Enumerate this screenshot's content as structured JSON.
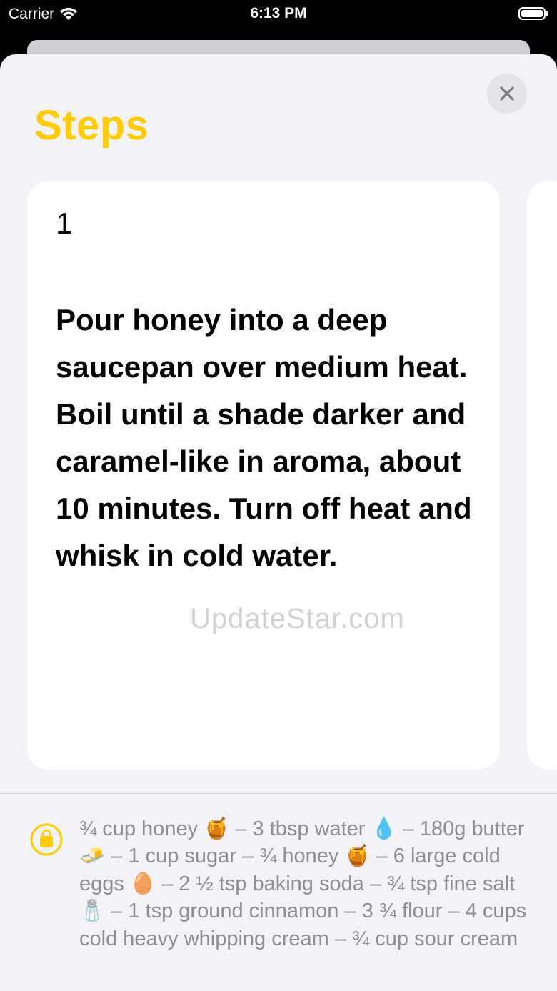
{
  "status_bar": {
    "carrier": "Carrier",
    "time": "6:13 PM"
  },
  "sheet": {
    "title": "Steps",
    "close_icon": "xmark-icon"
  },
  "step_card": {
    "number": "1",
    "text": "Pour honey into a deep saucepan over medium heat. Boil until a shade darker and caramel-like in aroma, about 10 minutes. Turn off heat and whisk in cold water."
  },
  "watermark": "UpdateStar.com",
  "ingredients": {
    "icon": "shopping-bag-icon",
    "text": "¾ cup honey 🍯 – 3 tbsp water 💧 – 180g butter 🧈 – 1 cup sugar – ¾ honey 🍯 – 6 large cold eggs 🥚 – 2 ½ tsp baking soda – ¾ tsp fine salt 🧂 – 1 tsp ground cinnamon – 3 ¾ flour – 4 cups cold heavy whipping cream – ¾ cup sour cream"
  },
  "colors": {
    "accent": "#ffcc00",
    "background": "#f2f2f7",
    "card": "#ffffff",
    "secondary_text": "#8e8e93"
  }
}
